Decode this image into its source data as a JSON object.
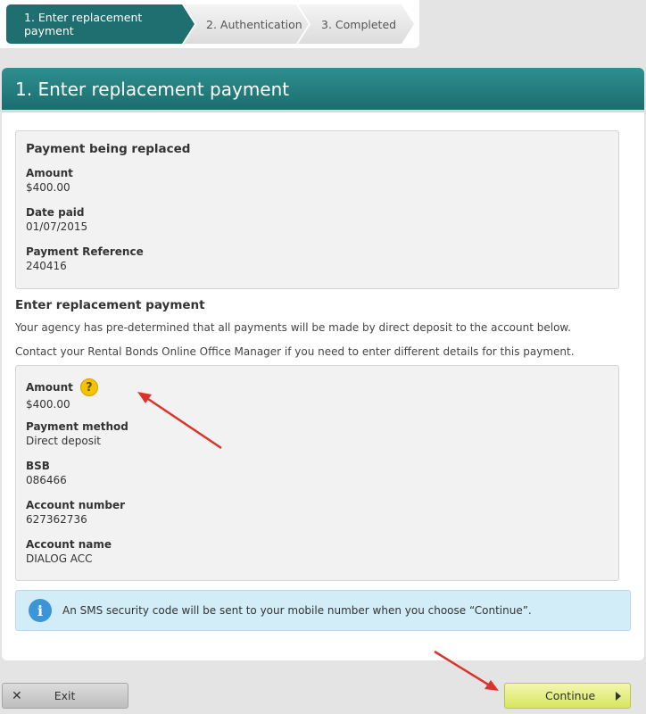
{
  "stepper": {
    "steps": [
      {
        "label": "1. Enter replacement payment",
        "active": true
      },
      {
        "label": "2. Authentication",
        "active": false
      },
      {
        "label": "3. Completed",
        "active": false
      }
    ]
  },
  "page_title": "1. Enter replacement payment",
  "replaced": {
    "title": "Payment being replaced",
    "fields": [
      {
        "label": "Amount",
        "value": "$400.00"
      },
      {
        "label": "Date paid",
        "value": "01/07/2015"
      },
      {
        "label": "Payment Reference",
        "value": "240416"
      }
    ]
  },
  "replacement": {
    "title": "Enter replacement payment",
    "note1": "Your agency has pre-determined that all payments will be made by direct deposit to the account below.",
    "note2": "Contact your Rental Bonds Online Office Manager if you need to enter different details for this payment.",
    "help_glyph": "?",
    "fields": [
      {
        "label": "Amount",
        "value": "$400.00"
      },
      {
        "label": "Payment method",
        "value": "Direct deposit"
      },
      {
        "label": "BSB",
        "value": "086466"
      },
      {
        "label": "Account number",
        "value": "627362736"
      },
      {
        "label": "Account name",
        "value": "DIALOG ACC"
      }
    ]
  },
  "info": {
    "glyph": "i",
    "text": "An SMS security code will be sent to your mobile number when you choose “Continue”."
  },
  "buttons": {
    "exit_label": "Exit",
    "exit_glyph": "✕",
    "continue_label": "Continue"
  },
  "colors": {
    "primary_teal": "#1f6f70",
    "continue_green": "#d6e65d",
    "annotation_red": "#d9342b",
    "info_blue": "#3b95d6",
    "help_yellow": "#f3c200"
  },
  "icons": [
    "help-icon",
    "info-icon",
    "close-icon",
    "arrow-right-icon"
  ]
}
